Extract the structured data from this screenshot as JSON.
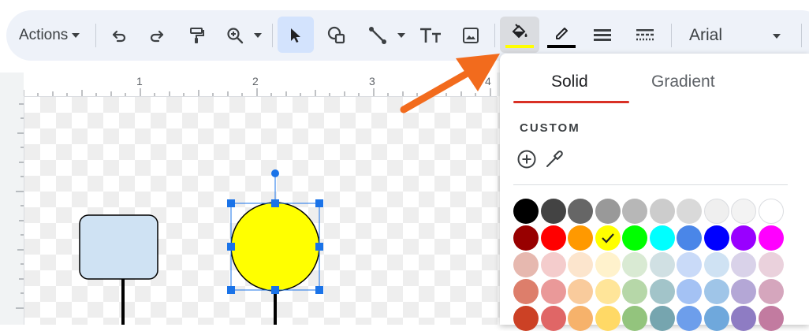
{
  "toolbar": {
    "actions_label": "Actions",
    "font_name": "Arial",
    "tools": [
      "undo-icon",
      "redo-icon",
      "paint-format-icon",
      "zoom-icon",
      "select-icon",
      "shape-icon",
      "line-icon",
      "text-box-icon",
      "image-icon",
      "fill-color-icon",
      "border-color-icon",
      "border-weight-icon",
      "border-dash-icon"
    ],
    "fill_indicator_color": "#ffff00",
    "border_indicator_color": "#000000"
  },
  "ruler": {
    "marks": [
      "1",
      "2",
      "3",
      "4"
    ]
  },
  "canvas": {
    "rounded_rect_fill": "#cfe2f3",
    "circle_fill": "#ffff00",
    "selection_color": "#1a73e8"
  },
  "color_panel": {
    "tabs": {
      "solid": "Solid",
      "gradient": "Gradient"
    },
    "active_tab": "Solid",
    "custom_label": "CUSTOM",
    "selected_color": "#ffff00",
    "palette": [
      [
        "#000000",
        "#434343",
        "#666666",
        "#999999",
        "#b7b7b7",
        "#cccccc",
        "#d9d9d9",
        "#efefef",
        "#f3f3f3",
        "#ffffff"
      ],
      [
        "#980000",
        "#ff0000",
        "#ff9900",
        "#ffff00",
        "#00ff00",
        "#00ffff",
        "#4a86e8",
        "#0000ff",
        "#9900ff",
        "#ff00ff"
      ],
      [
        "#e6b8af",
        "#f4cccc",
        "#fce5cd",
        "#fff2cc",
        "#d9ead3",
        "#d0e0e3",
        "#c9daf8",
        "#cfe2f3",
        "#d9d2e9",
        "#ead1dc"
      ],
      [
        "#dd7e6b",
        "#ea9999",
        "#f9cb9c",
        "#ffe599",
        "#b6d7a8",
        "#a2c4c9",
        "#a4c2f4",
        "#9fc5e8",
        "#b4a7d6",
        "#d5a6bd"
      ],
      [
        "#cc4125",
        "#e06666",
        "#f6b26b",
        "#ffd966",
        "#93c47d",
        "#76a5af",
        "#6d9eeb",
        "#6fa8dc",
        "#8e7cc3",
        "#c27ba0"
      ]
    ]
  },
  "annotation": {
    "arrow_color": "#f26b1d"
  }
}
